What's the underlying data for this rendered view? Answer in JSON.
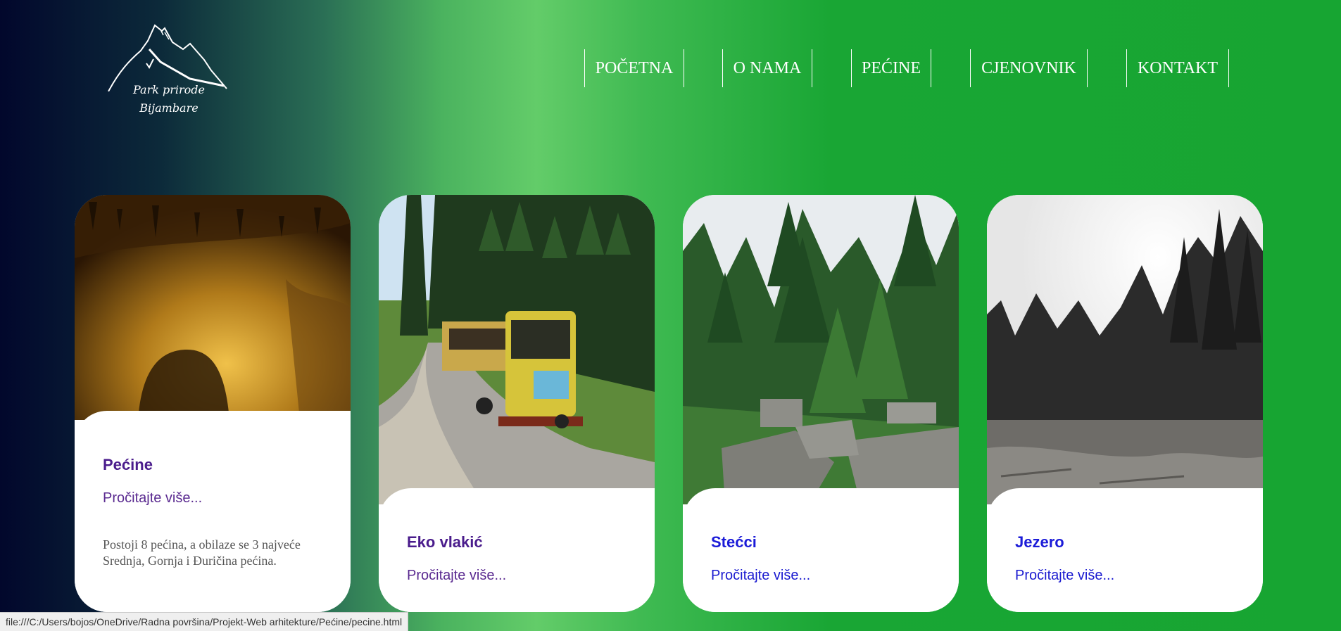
{
  "logo": {
    "line1": "Park prirode",
    "line2": "Bijambare"
  },
  "nav": [
    "POČETNA",
    "O NAMA",
    "PEĆINE",
    "CJENOVNIK",
    "KONTAKT"
  ],
  "cards": [
    {
      "title": "Pećine",
      "link": "Pročitajte više...",
      "description": "Postoji 8 pećina, a obilaze se 3 najveće Srednja, Gornja i Đuričina pećina.",
      "image": "cave-photo"
    },
    {
      "title": "Eko vlakić",
      "link": "Pročitajte više...",
      "image": "eco-train-photo"
    },
    {
      "title": "Stećci",
      "link": "Pročitajte više...",
      "image": "tombstones-forest-photo"
    },
    {
      "title": "Jezero",
      "link": "Pročitajte više...",
      "image": "lake-forest-photo"
    }
  ],
  "colors": {
    "title_visited": "#4a1c8c",
    "title_link": "#1b1bd8",
    "link_visited": "#5a2a90",
    "link_unvisited": "#1a1ad0"
  },
  "status_bar": {
    "url": "file:///C:/Users/bojos/OneDrive/Radna površina/Projekt-Web arhitekture/Pećine/pecine.html"
  }
}
